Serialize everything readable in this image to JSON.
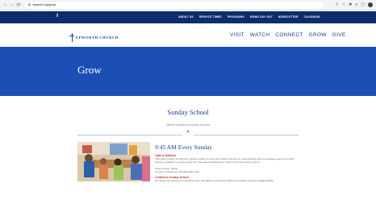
{
  "browser": {
    "url": "epworth.org/grow/",
    "back_icon": "arrow-left-icon",
    "forward_icon": "arrow-right-icon",
    "reload_icon": "reload-icon"
  },
  "topnav": {
    "social_icon": "f",
    "links": [
      "ABOUT US",
      "SERVICE TIMES",
      "PROGRAMS",
      "MOMS DAY OUT",
      "NEWSLETTER",
      "CALENDAR"
    ]
  },
  "header": {
    "logo_text": "EPWORTH CHURCH",
    "nav": [
      "VISIT",
      "WATCH",
      "CONNECT",
      "GROW",
      "GIVE"
    ]
  },
  "hero": {
    "title": "Grow",
    "background_color": "#1c4fb6"
  },
  "section": {
    "title": "Sunday School",
    "subtitle": "Offered parallel to worship services"
  },
  "class": {
    "time_title": "9:45 AM Every Sunday",
    "first_class": {
      "name": "Faith & Matthew",
      "description": "This class studies the Word by using a variety of curriculum that is focused on strengthening and encouraging each one's faith journey, in addition to group study, the class also participates in church and community projects.",
      "target": "Target Group: Adults",
      "location": "Location: Classroom off Fellowship Hall"
    },
    "second_class": {
      "name": "Children's Sunday School",
      "description": "All classes are focused on building a firm foundation by teaching Children principles through engaging Bible"
    }
  },
  "colors": {
    "nav_dark": "#0b2d6b",
    "brand_blue": "#1a3d8f",
    "accent_red": "#c0392b"
  }
}
